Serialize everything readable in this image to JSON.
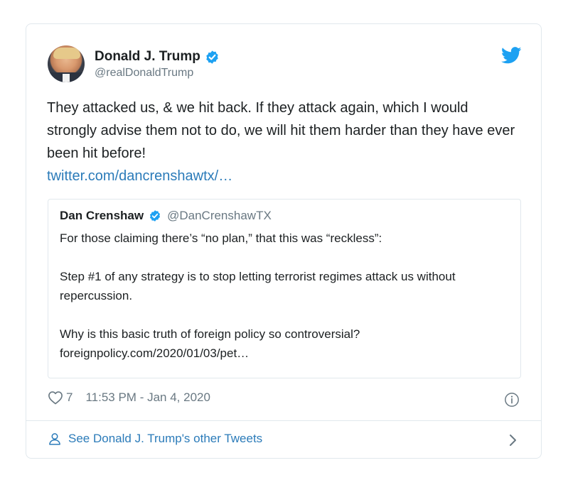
{
  "author": {
    "display_name": "Donald J. Trump",
    "handle": "@realDonaldTrump",
    "verified": true
  },
  "tweet": {
    "text": "They attacked us, & we hit back. If they attack again, which I would strongly advise them not to do, we will hit them harder than they have ever been hit before!",
    "link": "twitter.com/dancrenshawtx/…"
  },
  "quoted_tweet": {
    "display_name": "Dan Crenshaw",
    "handle": "@DanCrenshawTX",
    "verified": true,
    "paragraph_1": "For those claiming there’s “no plan,” that this was “reckless”:",
    "paragraph_2": "Step #1 of any strategy is to stop letting terrorist regimes attack us without repercussion.",
    "paragraph_3": "Why is this basic truth of foreign policy so controversial?foreignpolicy.com/2020/01/03/pet…"
  },
  "meta": {
    "likes": "7",
    "timestamp": "11:53 PM - Jan 4, 2020"
  },
  "footer": {
    "label": "See Donald J. Trump's other Tweets"
  },
  "icons": {
    "verified": "verified-badge-icon",
    "brand": "twitter-bird-icon",
    "like": "heart-icon",
    "info": "info-icon",
    "profile": "person-icon",
    "chevron": "chevron-right-icon"
  },
  "colors": {
    "link": "#2b7bb9",
    "verified": "#1da1f2",
    "secondary_text": "#697882",
    "border": "#e1e8ed"
  }
}
